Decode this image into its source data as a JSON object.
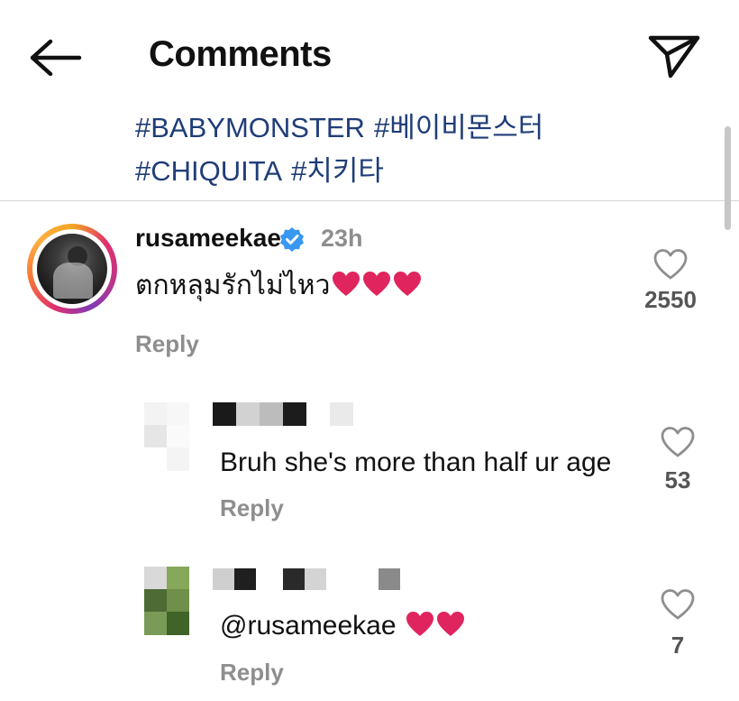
{
  "header": {
    "title": "Comments"
  },
  "caption": {
    "hashtags": [
      "#BABYMONSTER",
      "#베이비몬스터",
      "#CHIQUITA",
      "#치키타"
    ]
  },
  "comments": [
    {
      "username": "rusameekae",
      "verified": true,
      "time": "23h",
      "text": "ตกหลุมรักไม่ไหว",
      "hearts": 3,
      "like_count": "2550",
      "reply_label": "Reply"
    }
  ],
  "replies": [
    {
      "username_censored": true,
      "text": "Bruh she's more than half ur age",
      "like_count": "53",
      "reply_label": "Reply"
    },
    {
      "username_censored": true,
      "text": "@rusameekae",
      "hearts": 2,
      "like_count": "7",
      "reply_label": "Reply"
    }
  ],
  "icons": {
    "back": "arrow-left-icon",
    "send": "paper-plane-icon",
    "verified": "verified-badge-icon",
    "like": "heart-outline-icon",
    "emoji": "red-heart-icon"
  },
  "colors": {
    "hashtag": "#1f3d78",
    "muted": "#8e8e8e",
    "verified": "#3897f0",
    "heart": "#e0245e"
  }
}
